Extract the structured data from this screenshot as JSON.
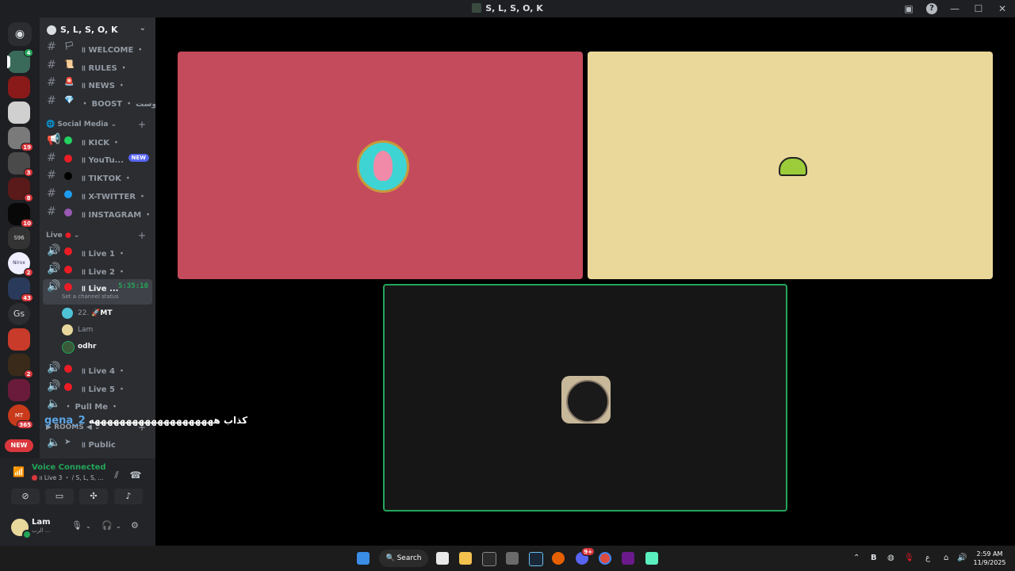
{
  "window": {
    "title": "S, L, S, O, K"
  },
  "server": {
    "name": "S, L, S, O, K"
  },
  "guilds": {
    "badges": [
      "4",
      "19",
      "3",
      "8",
      "10",
      "2",
      "43",
      "2",
      "365"
    ],
    "text_gs": "Gs",
    "new_label": "NEW",
    "icon_s96": "S96",
    "icon_nirvx": "Nirvx",
    "icon_mt": "MT"
  },
  "channels": {
    "welcome": "॥ WELCOME ・",
    "rules": "॥ RULES ・",
    "news": "॥ NEWS ・",
    "boost": "・ BOOST ・ بوست",
    "social_category": "Social Media",
    "kick": "॥ KICK ・",
    "youtube": "॥ YouTu...",
    "youtube_new": "NEW",
    "tiktok": "॥ TIKTOK ・",
    "twitter": "॥ X-TWITTER ・",
    "instagram": "॥ INSTAGRAM ・",
    "live_category": "Live",
    "live1": "॥ Live 1 ・",
    "live2": "॥ Live 2 ・",
    "live3": "॥ Live ...",
    "live3_timer": "5:35:10",
    "live3_status": "Set a channel status",
    "live4": "॥ Live 4 ・",
    "live5": "॥ Live 5 ・",
    "pullme": "・ Pull Me ・",
    "rooms_category": "ROOMS",
    "public": "॥ Public"
  },
  "voice_users": [
    {
      "name": "22. ",
      "suffix": "MT",
      "color": "#4fc3d6"
    },
    {
      "name": "Lam",
      "color": "#e8d89b"
    },
    {
      "name": "odhr",
      "color": "#3a5a3a"
    }
  ],
  "chat_overlay": {
    "username": "gena_2",
    "message": "كذاب ههههههههههههههههههههه"
  },
  "voice_panel": {
    "status": "Voice Connected",
    "sub": "॥ Live 3 ・ / S, L, S, ..."
  },
  "user": {
    "name": "Lam",
    "sub": "الرب ..."
  },
  "videos": [
    {
      "color": "#c44b5c",
      "label": "video-tile-patrick"
    },
    {
      "color": "#ead89b",
      "label": "video-tile-lam"
    },
    {
      "color": "#161616",
      "label": "video-tile-odhr",
      "speaking": true
    }
  ],
  "taskbar": {
    "search": "Search",
    "time": "2:59 AM",
    "date": "11/9/2025",
    "discord_badge": "9+",
    "lang": "ع"
  }
}
